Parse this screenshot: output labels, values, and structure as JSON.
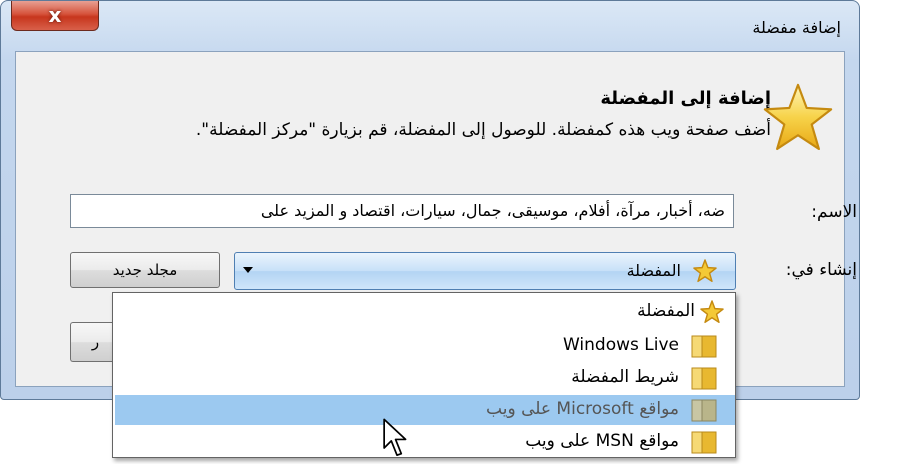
{
  "window": {
    "title": "إضافة مفضلة",
    "close_glyph": "x"
  },
  "header": {
    "heading": "إضافة إلى المفضلة",
    "description": "أضف صفحة ويب هذه كمفضلة. للوصول إلى المفضلة، قم بزيارة \"مركز المفضلة\"."
  },
  "form": {
    "name_label": "الاسم:",
    "name_value": "ضه، أخبار، مرآة، أفلام، موسيقى، جمال، سيارات، اقتصاد و المزيد على",
    "create_in_label": "إنشاء في:",
    "create_in_value": "المفضلة",
    "new_folder_label": "مجلد جديد",
    "partial_button_label": "ر"
  },
  "dropdown": {
    "items": [
      {
        "label": "المفضلة",
        "icon": "star-icon",
        "selected": false
      },
      {
        "label": "Windows Live",
        "icon": "folder-icon",
        "selected": false
      },
      {
        "label": "شريط المفضلة",
        "icon": "folder-icon",
        "selected": false
      },
      {
        "label": "مواقع Microsoft على ويب",
        "icon": "folder-icon",
        "selected": true
      },
      {
        "label": "مواقع MSN على ويب",
        "icon": "folder-icon",
        "selected": false
      }
    ]
  },
  "colors": {
    "selection": "#9cc9f0",
    "close_button": "#c7361d",
    "star": "#f2c12e"
  }
}
